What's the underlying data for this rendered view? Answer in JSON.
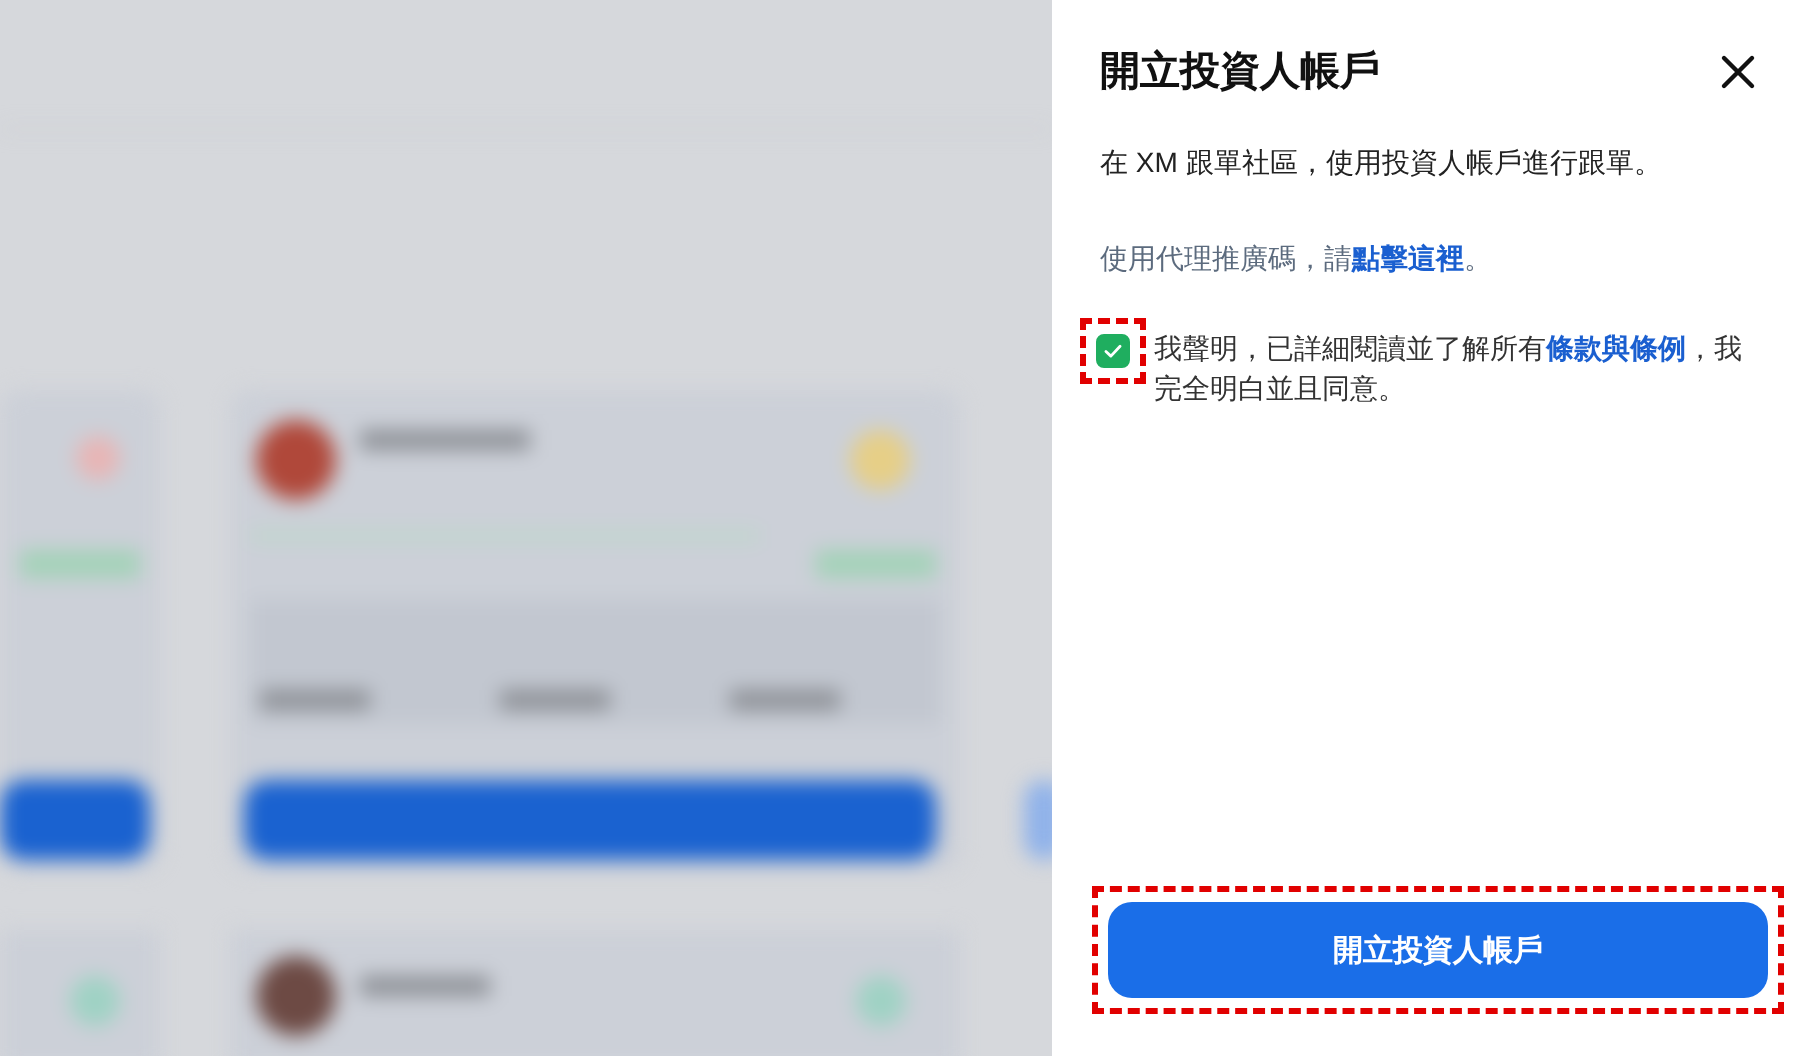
{
  "drawer": {
    "title": "開立投資人帳戶",
    "intro": "在 XM 跟單社區，使用投資人帳戶進行跟單。",
    "referral": "使用代理推廣碼，請**點擊這裡**。",
    "agreement": {
      "checked": true,
      "highlighted": true,
      "text": "我聲明，已詳細閱讀並了解所有**條款與條例**，我完全明白並且同意。"
    },
    "submit": {
      "label": "開立投資人帳戶",
      "highlighted": true
    }
  }
}
